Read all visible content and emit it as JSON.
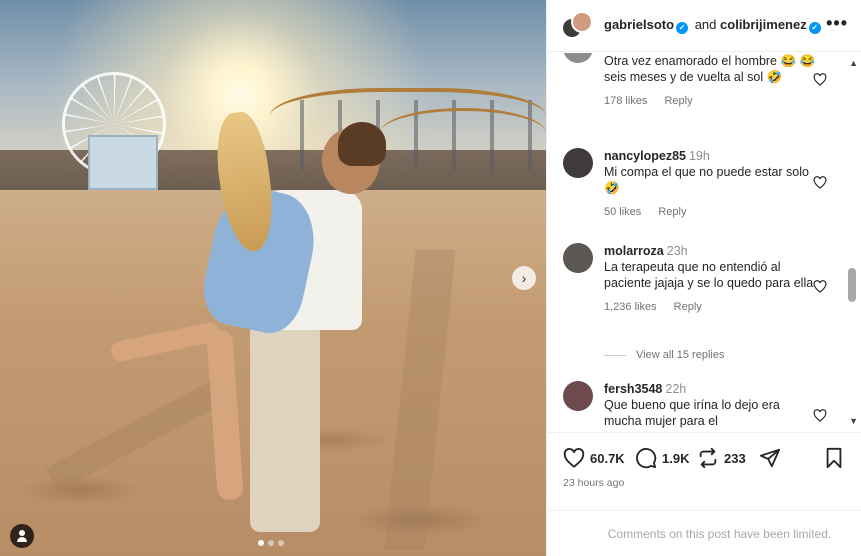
{
  "post": {
    "carousel_count": 3,
    "carousel_active": 1
  },
  "header": {
    "user1": "gabrielsoto",
    "and": "and",
    "user2": "colibrijimenez",
    "more": "•••"
  },
  "comments": [
    {
      "username": "",
      "time": "",
      "text": "Otra vez enamorado el hombre 😂 😂 seis meses y de vuelta al sol 🤣",
      "likes": "178 likes",
      "reply": "Reply"
    },
    {
      "username": "nancylopez85",
      "time": "19h",
      "text": "Mi compa el que no puede estar solo 🤣",
      "likes": "50 likes",
      "reply": "Reply"
    },
    {
      "username": "molarroza",
      "time": "23h",
      "text": "La terapeuta que no entendió al paciente jajaja y se lo quedo para ella",
      "likes": "1,236 likes",
      "reply": "Reply",
      "view_replies": "View all 15 replies"
    },
    {
      "username": "fersh3548",
      "time": "22h",
      "text": "Que bueno que irína lo dejo era mucha mujer para el",
      "likes": "",
      "reply": ""
    }
  ],
  "actions": {
    "likes_count": "60.7K",
    "comments_count": "1.9K",
    "reposts_count": "233"
  },
  "timestamp": "23 hours ago",
  "limited_notice": "Comments on this post have been limited.",
  "colors": {
    "verified": "#0095f6",
    "text": "#262626",
    "muted": "#737373"
  }
}
